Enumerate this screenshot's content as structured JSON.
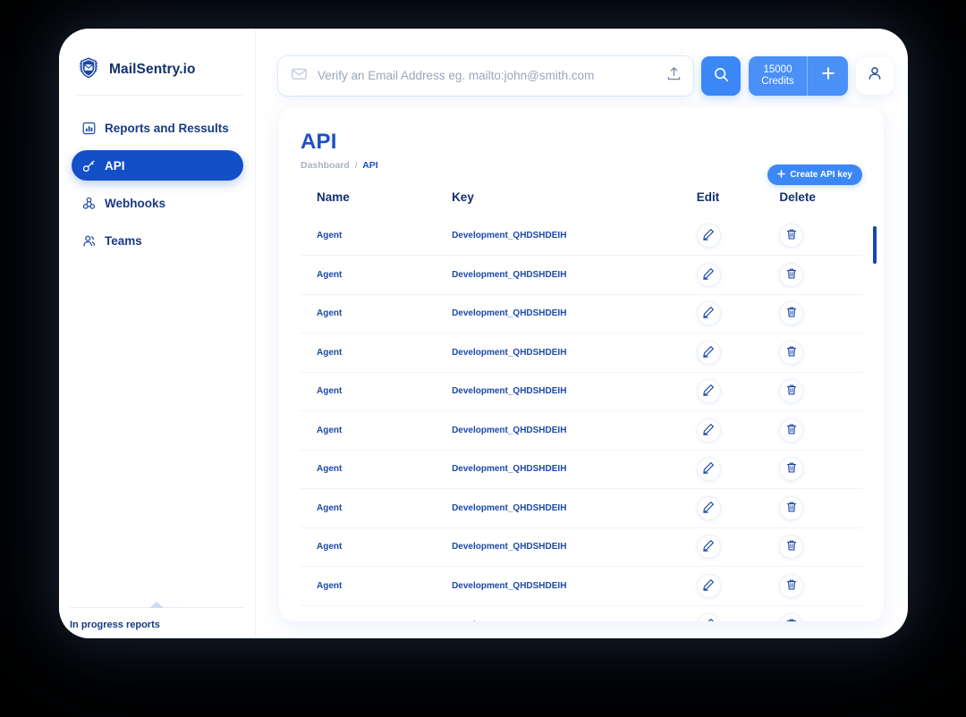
{
  "brand": {
    "name": "MailSentry.io",
    "logo_icon": "shield-envelope-icon"
  },
  "sidebar": {
    "items": [
      {
        "label": "Reports and Ressults",
        "icon": "chart-bar-icon",
        "active": false
      },
      {
        "label": "API",
        "icon": "api-key-icon",
        "active": true
      },
      {
        "label": "Webhooks",
        "icon": "webhook-icon",
        "active": false
      },
      {
        "label": "Teams",
        "icon": "people-icon",
        "active": false
      }
    ],
    "footer_label": "In progress reports"
  },
  "header": {
    "search": {
      "placeholder": "Verify an Email Address eg. mailto:john@smith.com",
      "value": "",
      "mail_icon": "envelope-icon"
    },
    "upload_icon": "upload-icon",
    "search_button_icon": "search-icon",
    "credits": {
      "amount": "15000",
      "label": "Credits"
    },
    "add_icon": "plus-icon",
    "avatar_icon": "user-icon"
  },
  "main": {
    "title": "API",
    "breadcrumb": {
      "root": "Dashboard",
      "separator": "/",
      "current": "API"
    },
    "create_button": {
      "label": "Create API key",
      "icon": "plus-icon"
    },
    "table": {
      "columns": [
        "Name",
        "Key",
        "Edit",
        "Delete"
      ],
      "edit_icon": "pencil-icon",
      "delete_icon": "trash-icon",
      "rows": [
        {
          "name": "Agent",
          "key": "Development_QHDSHDEIH"
        },
        {
          "name": "Agent",
          "key": "Development_QHDSHDEIH"
        },
        {
          "name": "Agent",
          "key": "Development_QHDSHDEIH"
        },
        {
          "name": "Agent",
          "key": "Development_QHDSHDEIH"
        },
        {
          "name": "Agent",
          "key": "Development_QHDSHDEIH"
        },
        {
          "name": "Agent",
          "key": "Development_QHDSHDEIH"
        },
        {
          "name": "Agent",
          "key": "Development_QHDSHDEIH"
        },
        {
          "name": "Agent",
          "key": "Development_QHDSHDEIH"
        },
        {
          "name": "Agent",
          "key": "Development_QHDSHDEIH"
        },
        {
          "name": "Agent",
          "key": "Development_QHDSHDEIH"
        },
        {
          "name": "Agent",
          "key": "Development_QHDSHDEIH"
        }
      ]
    }
  },
  "colors": {
    "accent_blue": "#3b87f6",
    "deep_blue": "#1350c8",
    "navy": "#13306e",
    "background": "#000000"
  }
}
